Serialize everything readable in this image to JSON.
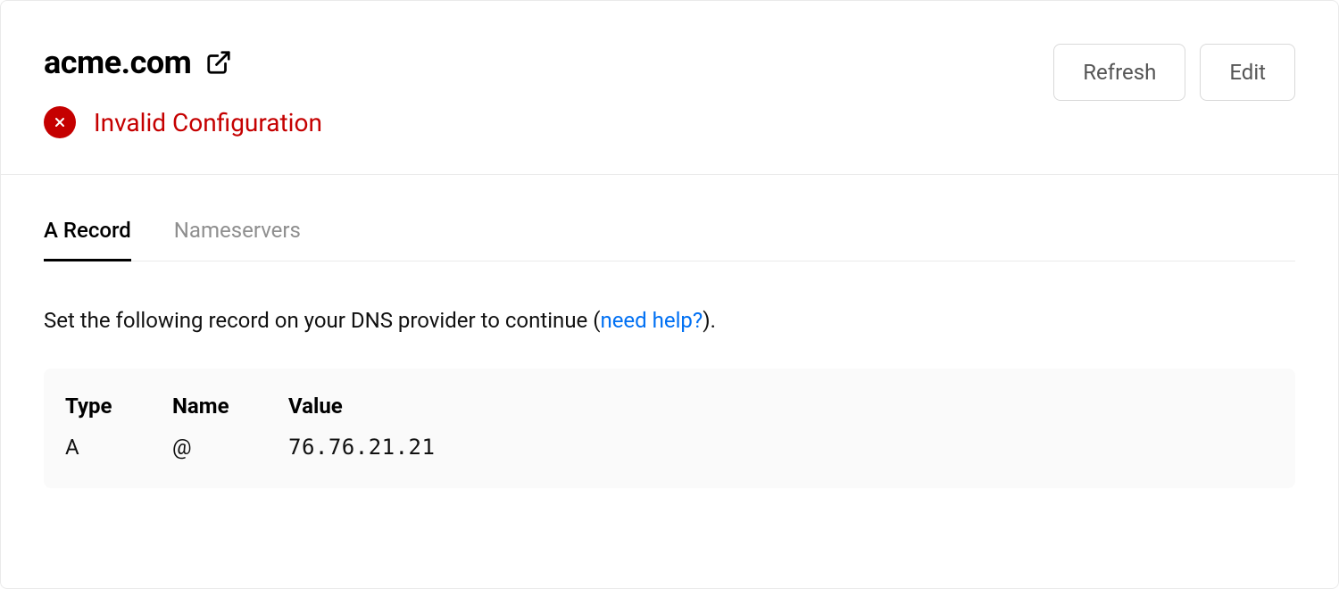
{
  "header": {
    "domain": "acme.com",
    "status_text": "Invalid Configuration"
  },
  "actions": {
    "refresh_label": "Refresh",
    "edit_label": "Edit"
  },
  "tabs": [
    {
      "label": "A Record",
      "active": true
    },
    {
      "label": "Nameservers",
      "active": false
    }
  ],
  "instruction": {
    "text_pre": "Set the following record on your DNS provider to continue (",
    "help_link": "need help?",
    "text_post": ")."
  },
  "record": {
    "headers": {
      "type": "Type",
      "name": "Name",
      "value": "Value"
    },
    "row": {
      "type": "A",
      "name": "@",
      "value": "76.76.21.21"
    }
  },
  "colors": {
    "error": "#c50000",
    "accent": "#0070f3"
  }
}
